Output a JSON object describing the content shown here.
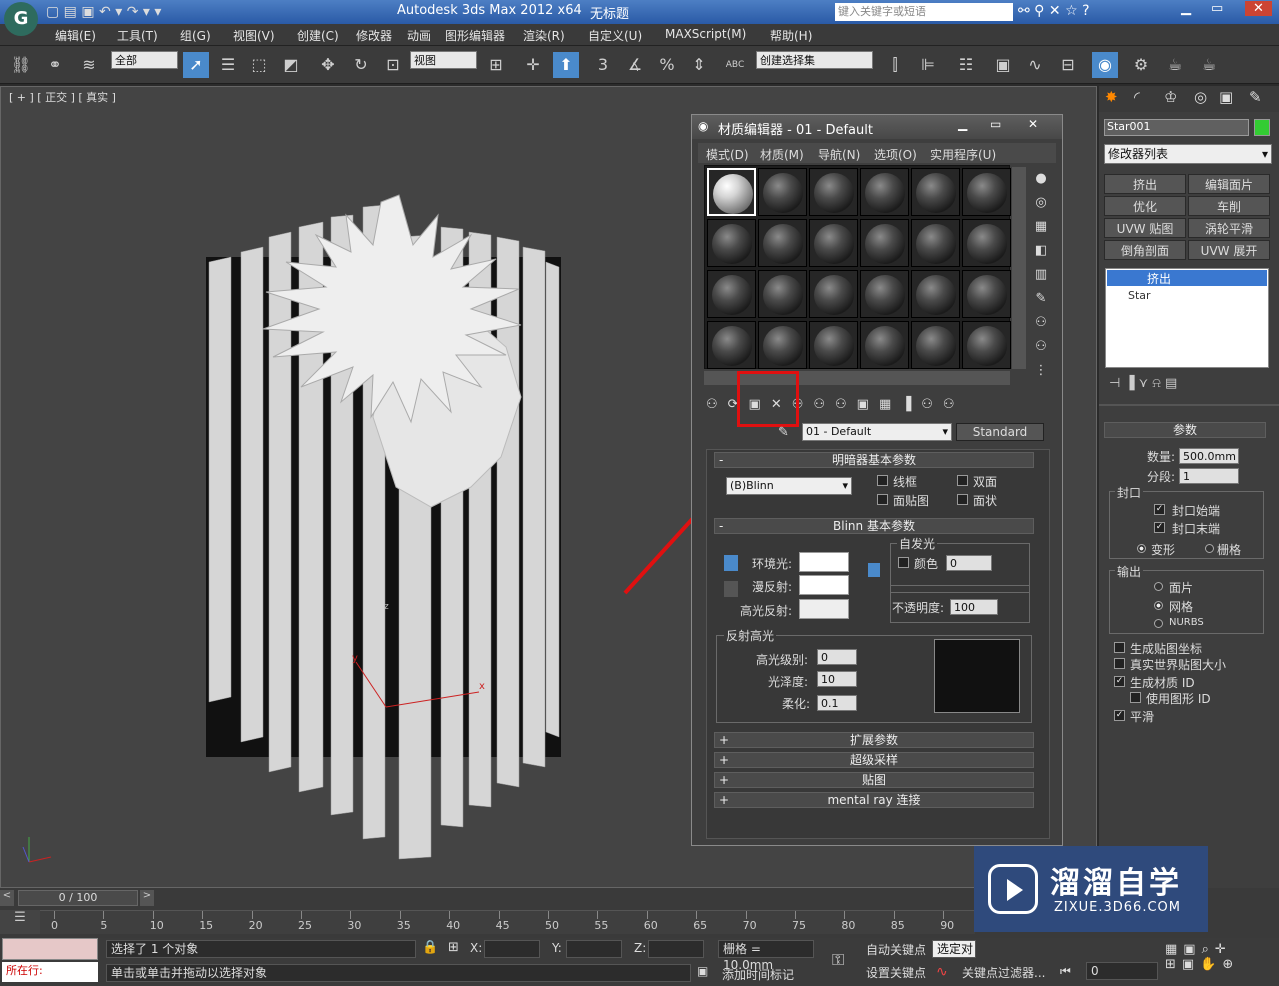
{
  "app_title": "Autodesk 3ds Max  2012 x64",
  "doc_title": "无标题",
  "search_placeholder": "键入关键字或短语",
  "menus": [
    "编辑(E)",
    "工具(T)",
    "组(G)",
    "视图(V)",
    "创建(C)",
    "修改器",
    "动画",
    "图形编辑器",
    "渲染(R)",
    "自定义(U)",
    "MAXScript(M)",
    "帮助(H)"
  ],
  "toolbar": {
    "selection_filter": "全部",
    "ref_coord": "视图",
    "named_sel": "创建选择集",
    "snap_3": "3",
    "snap_2": "2",
    "percent": "%",
    "abc": "ABC"
  },
  "viewport": {
    "label": "[ + ] [ 正交 ] [ 真实 ]",
    "axis_x": "x",
    "axis_y": "y",
    "axis_z": "z"
  },
  "material_editor": {
    "title": "材质编辑器 - 01 - Default",
    "menus": [
      "模式(D)",
      "材质(M)",
      "导航(N)",
      "选项(O)",
      "实用程序(U)"
    ],
    "material_name": "01 - Default",
    "material_type": "Standard",
    "rollout_shader": "明暗器基本参数",
    "shader": "(B)Blinn",
    "shader_options": [
      "线框",
      "双面",
      "面贴图",
      "面状"
    ],
    "rollout_blinn": "Blinn 基本参数",
    "self_illum": "自发光",
    "color_label": "颜色",
    "color_value": "0",
    "ambient": "环境光:",
    "diffuse": "漫反射:",
    "specular": "高光反射:",
    "opacity_label": "不透明度:",
    "opacity_value": "100",
    "spec_highlights": "反射高光",
    "spec_level_label": "高光级别:",
    "spec_level": "0",
    "glossiness_label": "光泽度:",
    "glossiness": "10",
    "soften_label": "柔化:",
    "soften": "0.1",
    "rollouts_closed": [
      "扩展参数",
      "超级采样",
      "贴图",
      "mental ray 连接"
    ]
  },
  "command_panel": {
    "object_name": "Star001",
    "modifier_list": "修改器列表",
    "modifier_buttons": [
      "挤出",
      "编辑面片",
      "优化",
      "车削",
      "UVW 贴图",
      "涡轮平滑",
      "倒角剖面",
      "UVW 展开"
    ],
    "stack": [
      "挤出",
      "Star"
    ],
    "params_title": "参数",
    "amount_label": "数量:",
    "amount": "500.0mm",
    "segments_label": "分段:",
    "segments": "1",
    "capping_title": "封口",
    "cap_start": "封口始端",
    "cap_end": "封口末端",
    "morph": "变形",
    "grid": "栅格",
    "output_title": "输出",
    "out_patch": "面片",
    "out_mesh": "网格",
    "out_nurbs": "NURBS",
    "gen_map_coords": "生成贴图坐标",
    "real_world": "真实世界贴图大小",
    "gen_mat_ids": "生成材质 ID",
    "use_shape_ids": "使用图形 ID",
    "smooth": "平滑"
  },
  "timeline": {
    "frame": "0 / 100",
    "ticks": [
      "0",
      "5",
      "10",
      "15",
      "20",
      "25",
      "30",
      "35",
      "40",
      "45",
      "50",
      "55",
      "60",
      "65",
      "70",
      "75",
      "80",
      "85",
      "90"
    ]
  },
  "status": {
    "selected": "选择了 1 个对象",
    "prompt": "单击或单击并拖动以选择对象",
    "running": "所在行:",
    "x_label": "X:",
    "y_label": "Y:",
    "z_label": "Z:",
    "grid": "栅格 = 10.0mm",
    "add_time_tag": "添加时间标记",
    "auto_key": "自动关键点",
    "set_key": "设置关键点",
    "selected_obj": "选定对",
    "key_filters": "关键点过滤器...",
    "frame_field": "0"
  },
  "watermark": {
    "brand": "溜溜自学",
    "url": "ZIXUE.3D66.COM"
  },
  "accent_red": "#e01010"
}
